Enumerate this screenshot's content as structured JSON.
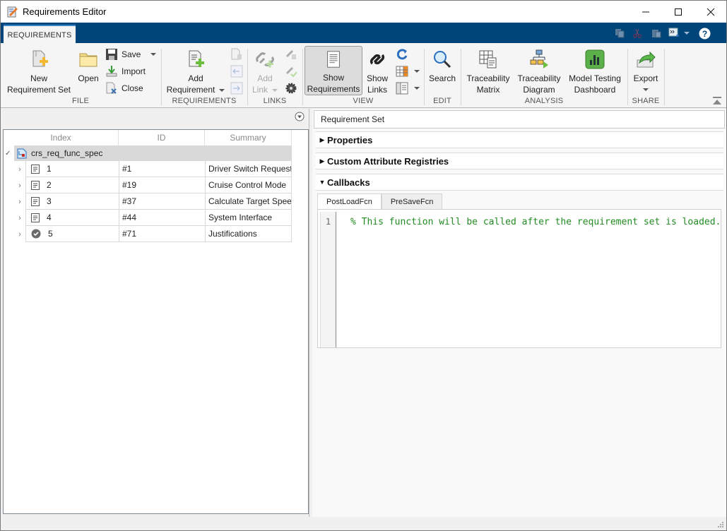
{
  "window": {
    "title": "Requirements Editor",
    "controls": [
      "minimize-icon",
      "maximize-icon",
      "close-icon"
    ]
  },
  "tabs": [
    {
      "label": "REQUIREMENTS",
      "active": true
    }
  ],
  "quick_access": [
    "copy-icon",
    "cut-icon",
    "paste-icon",
    "command-icon",
    "help-icon"
  ],
  "ribbon": {
    "groups": [
      {
        "label": "FILE",
        "buttons": [
          {
            "label": "New Requirement Set",
            "icon": "new-requirement-set-icon"
          },
          {
            "label": "Open",
            "icon": "open-folder-icon"
          },
          {
            "label": "Save",
            "icon": "save-icon"
          },
          {
            "label": "Import",
            "icon": "import-icon"
          },
          {
            "label": "Close",
            "icon": "close-file-icon"
          }
        ]
      },
      {
        "label": "REQUIREMENTS",
        "buttons": [
          {
            "label": "Add Requirement",
            "icon": "add-requirement-icon"
          }
        ]
      },
      {
        "label": "LINKS",
        "buttons": [
          {
            "label": "Add Link",
            "icon": "add-link-icon",
            "disabled": true
          }
        ]
      },
      {
        "label": "VIEW",
        "buttons": [
          {
            "label": "Show Requirements",
            "icon": "show-requirements-icon",
            "active": true
          },
          {
            "label": "Show Links",
            "icon": "show-links-icon"
          }
        ]
      },
      {
        "label": "EDIT",
        "buttons": [
          {
            "label": "Search",
            "icon": "search-icon"
          }
        ]
      },
      {
        "label": "ANALYSIS",
        "buttons": [
          {
            "label": "Traceability Matrix",
            "icon": "traceability-matrix-icon"
          },
          {
            "label": "Traceability Diagram",
            "icon": "traceability-diagram-icon"
          },
          {
            "label": "Model Testing Dashboard",
            "icon": "dashboard-icon"
          }
        ]
      },
      {
        "label": "SHARE",
        "buttons": [
          {
            "label": "Export",
            "icon": "export-icon"
          }
        ]
      }
    ],
    "labels": {
      "new_line1": "New",
      "new_line2": "Requirement Set",
      "open": "Open",
      "save": "Save",
      "import": "Import",
      "close": "Close",
      "add_req_line1": "Add",
      "add_req_line2": "Requirement",
      "add_link_line1": "Add",
      "add_link_line2": "Link",
      "show_req_line1": "Show",
      "show_req_line2": "Requirements",
      "show_links_line1": "Show",
      "show_links_line2": "Links",
      "search": "Search",
      "tm_line1": "Traceability",
      "tm_line2": "Matrix",
      "td_line1": "Traceability",
      "td_line2": "Diagram",
      "mtd_line1": "Model Testing",
      "mtd_line2": "Dashboard",
      "export": "Export"
    }
  },
  "tree": {
    "columns": [
      "Index",
      "ID",
      "Summary"
    ],
    "root": {
      "label": "crs_req_func_spec",
      "expanded": true
    },
    "rows": [
      {
        "index": "1",
        "id": "#1",
        "summary": "Driver Switch Request...",
        "icon": "requirement-icon"
      },
      {
        "index": "2",
        "id": "#19",
        "summary": "Cruise Control Mode",
        "icon": "requirement-icon"
      },
      {
        "index": "3",
        "id": "#37",
        "summary": "Calculate Target Spee...",
        "icon": "requirement-icon"
      },
      {
        "index": "4",
        "id": "#44",
        "summary": "System Interface",
        "icon": "requirement-icon"
      },
      {
        "index": "5",
        "id": "#71",
        "summary": "Justifications",
        "icon": "justification-icon"
      }
    ]
  },
  "details": {
    "header": "Requirement Set",
    "sections": [
      {
        "label": "Properties",
        "expanded": false
      },
      {
        "label": "Custom Attribute Registries",
        "expanded": false
      },
      {
        "label": "Callbacks",
        "expanded": true
      }
    ],
    "callback_tabs": [
      {
        "label": "PostLoadFcn",
        "active": true
      },
      {
        "label": "PreSaveFcn",
        "active": false
      }
    ],
    "editor": {
      "lines": [
        {
          "number": "1",
          "text": "% This function will be called after the requirement set is loaded."
        }
      ]
    }
  }
}
